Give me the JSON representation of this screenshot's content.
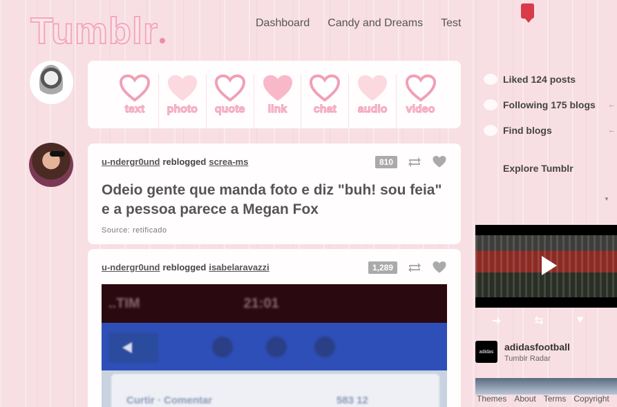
{
  "brand": {
    "logo_text": "Tumblr"
  },
  "nav": {
    "items": [
      "Dashboard",
      "Candy and Dreams",
      "Test"
    ]
  },
  "composer": {
    "types": [
      "text",
      "photo",
      "quote",
      "link",
      "chat",
      "audio",
      "video"
    ]
  },
  "posts": [
    {
      "user": "u-ndergr0und",
      "verb": "reblogged",
      "source_user": "screa-ms",
      "notes": "810",
      "title": "Odeio gente que manda foto e diz \"buh! sou feia\" e a pessoa parece a Megan Fox",
      "source_line": "Source: retificado"
    },
    {
      "user": "u-ndergr0und",
      "verb": "reblogged",
      "source_user": "isabelaravazzi",
      "notes": "1,289",
      "photo": {
        "status_left": "..TIM",
        "status_time": "21:01",
        "card_left": "Curtir · Comentar",
        "card_right": "583  12"
      }
    }
  ],
  "sidebar": {
    "liked": "Liked 124 posts",
    "following": "Following 175 blogs",
    "find": "Find blogs",
    "explore": "Explore Tumblr"
  },
  "radar": {
    "name": "adidasfootball",
    "label": "Tumblr Radar",
    "logo_text": "adidas"
  },
  "footer": {
    "links": [
      "Themes",
      "About",
      "Terms",
      "Copyright"
    ]
  },
  "colors": {
    "accent_pink": "#f19fb6",
    "notification": "#d93b48",
    "note_badge": "#aaaaaa"
  }
}
